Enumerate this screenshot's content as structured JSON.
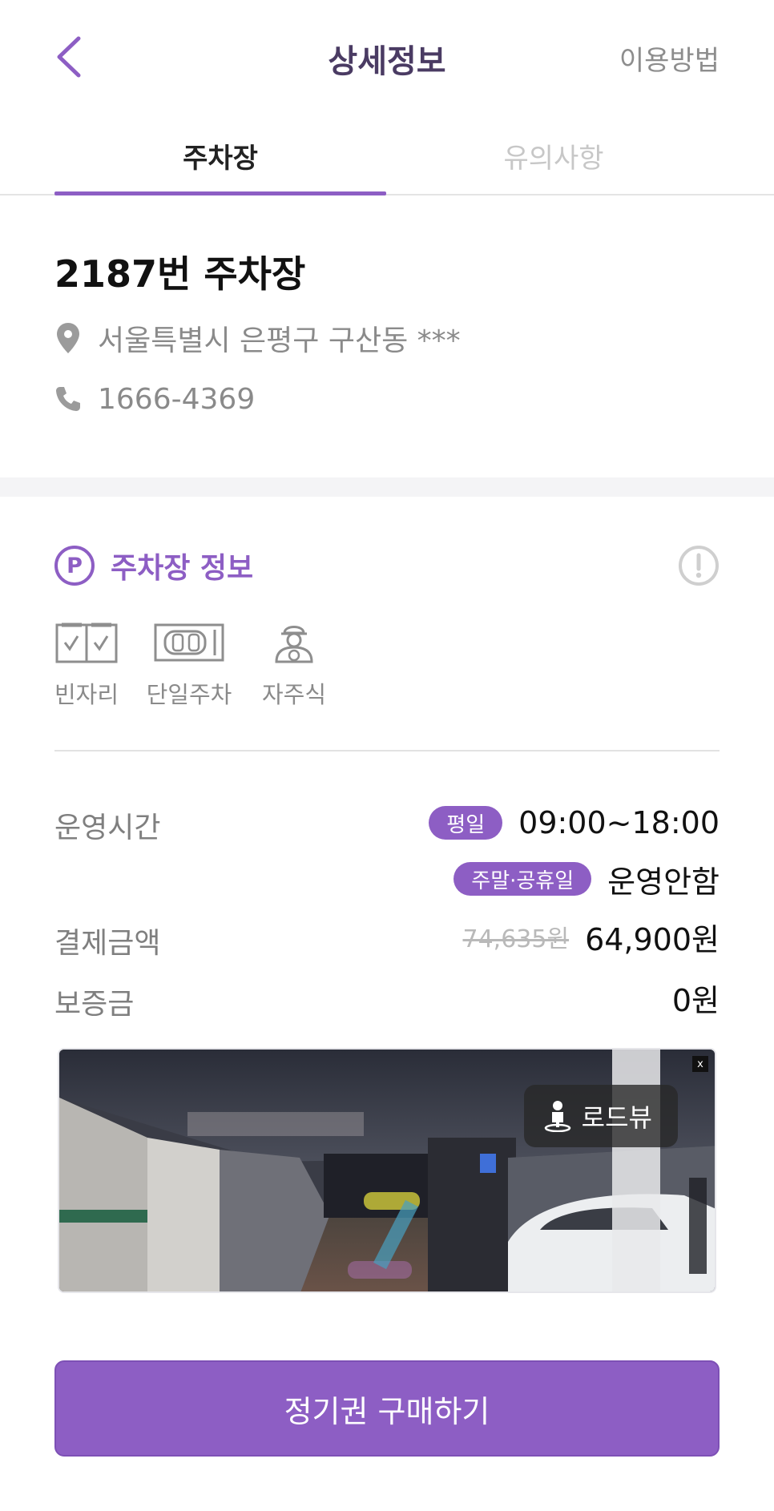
{
  "header": {
    "title": "상세정보",
    "help_label": "이용방법"
  },
  "tabs": [
    {
      "label": "주차장",
      "active": true
    },
    {
      "label": "유의사항",
      "active": false
    }
  ],
  "lot": {
    "name": "2187번 주차장",
    "address": "서울특별시 은평구 구산동 ***",
    "phone": "1666-4369"
  },
  "info": {
    "p_symbol": "P",
    "title": "주차장 정보",
    "features": [
      {
        "icon": "vacant-spaces-icon",
        "label": "빈자리"
      },
      {
        "icon": "single-parking-icon",
        "label": "단일주차"
      },
      {
        "icon": "self-parking-icon",
        "label": "자주식"
      }
    ]
  },
  "hours": {
    "label": "운영시간",
    "weekday_tag": "평일",
    "weekday_value": "09:00~18:00",
    "weekend_tag": "주말·공휴일",
    "weekend_value": "운영안함"
  },
  "payment": {
    "label": "결제금액",
    "original_price": "74,635원",
    "price": "64,900원"
  },
  "deposit": {
    "label": "보증금",
    "value": "0원"
  },
  "roadview": {
    "button_label": "로드뷰",
    "close_label": "x"
  },
  "purchase_button": "정기권 구매하기",
  "colors": {
    "accent": "#8d5ec4",
    "title": "#4a3b63"
  }
}
